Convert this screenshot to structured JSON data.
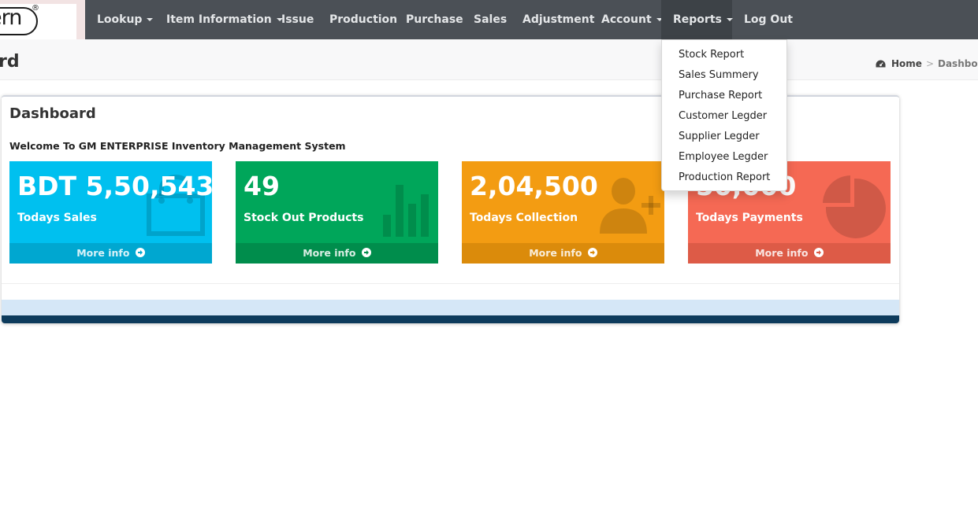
{
  "brand": {
    "logo_text": "ern",
    "logo_mark": "®"
  },
  "nav": {
    "items": [
      {
        "label": "Lookup",
        "has_caret": true
      },
      {
        "label": "Item Information",
        "has_caret": true
      },
      {
        "label": "Issue",
        "has_caret": false
      },
      {
        "label": "Production",
        "has_caret": false
      },
      {
        "label": "Purchase",
        "has_caret": false
      },
      {
        "label": "Sales",
        "has_caret": false
      },
      {
        "label": "Adjustment",
        "has_caret": false
      },
      {
        "label": "Account",
        "has_caret": true
      },
      {
        "label": "Reports",
        "has_caret": true,
        "active": true
      },
      {
        "label": "Log Out",
        "has_caret": false
      }
    ]
  },
  "reports_menu": {
    "items": [
      "Stock Report",
      "Sales Summery",
      "Purchase Report",
      "Customer Legder",
      "Supplier Legder",
      "Employee Legder",
      "Production Report"
    ]
  },
  "header": {
    "title": "rd",
    "breadcrumb": {
      "home": "Home",
      "current": "Dashboard",
      "separator": ">"
    }
  },
  "panel": {
    "title": "Dashboard",
    "welcome": "Welcome To GM ENTERPRISE Inventory Management System"
  },
  "boxes": [
    {
      "value": "BDT 5,50,543",
      "label": "Todays Sales",
      "footer": "More info",
      "color": "#00c0ef",
      "icon": "shopping-bag-icon"
    },
    {
      "value": "49",
      "label": "Stock Out Products",
      "footer": "More info",
      "color": "#00a65a",
      "icon": "bar-chart-icon"
    },
    {
      "value": "2,04,500",
      "label": "Todays Collection",
      "footer": "More info",
      "color": "#f39c12",
      "icon": "user-add-icon"
    },
    {
      "value": "50,000",
      "label": "Todays Payments",
      "footer": "More info",
      "color": "#f56954",
      "icon": "pie-chart-icon"
    }
  ],
  "colors": {
    "navbar": "#4b5056",
    "panel_footer": "#0d3b5c"
  }
}
